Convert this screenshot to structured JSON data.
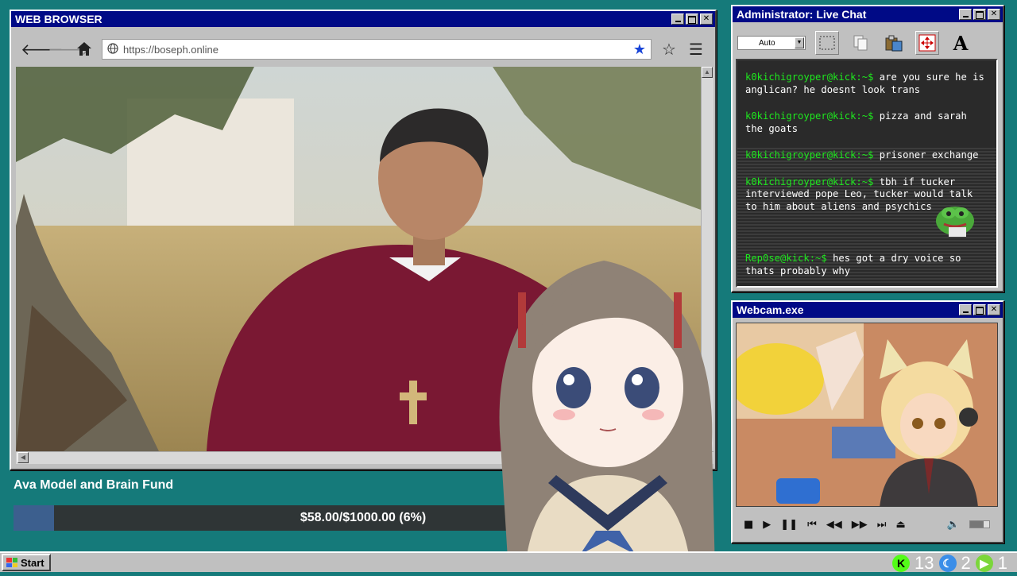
{
  "browser": {
    "title": "WEB BROWSER",
    "url": "https://boseph.online",
    "icons": {
      "back": "arrow-left-icon",
      "forward": "arrow-right-icon",
      "home": "home-icon",
      "bookmarked": "star-filled-icon",
      "bookmark": "star-outline-icon",
      "menu": "hamburger-icon"
    }
  },
  "chat": {
    "title": "Administrator: Live Chat",
    "font_select": "Auto",
    "tools": [
      "selection-icon",
      "copy-icon",
      "paste-icon",
      "move-icon",
      "text-icon"
    ],
    "messages": [
      {
        "user": "k0kichigroyper@kick:~$",
        "text": "are you sure he is anglican? he doesnt look trans"
      },
      {
        "user": "k0kichigroyper@kick:~$",
        "text": "pizza and sarah the goats"
      },
      {
        "user": "k0kichigroyper@kick:~$",
        "text": "prisoner exchange"
      },
      {
        "user": "k0kichigroyper@kick:~$",
        "text": "tbh if tucker interviewed pope Leo, tucker would talk to him about aliens and psychics"
      },
      {
        "user": "Rep0se@kick:~$",
        "text": "hes got a dry voice so thats probably why"
      }
    ]
  },
  "webcam": {
    "title": "Webcam.exe",
    "controls": [
      "stop-icon",
      "play-icon",
      "pause-icon",
      "skip-back-icon",
      "rewind-icon",
      "fast-forward-icon",
      "skip-forward-icon",
      "eject-icon",
      "volume-icon"
    ]
  },
  "fund": {
    "title": "Ava Model and Brain Fund",
    "progress_text": "$58.00/$1000.00 (6%)",
    "raised": 58,
    "goal": 1000,
    "percent": 6
  },
  "taskbar": {
    "start_label": "Start",
    "tray": [
      {
        "icon": "kick-icon",
        "count": "13",
        "color": "#53fc18"
      },
      {
        "icon": "moon-icon",
        "count": "2",
        "color": "#3b8ee8"
      },
      {
        "icon": "play-circle-icon",
        "count": "1",
        "color": "#7bd63a"
      }
    ]
  },
  "colors": {
    "desktop": "#157a7a",
    "titlebar": "#000a86",
    "chat_username": "#1ee81e",
    "fund_fill": "#3c5f8e"
  }
}
